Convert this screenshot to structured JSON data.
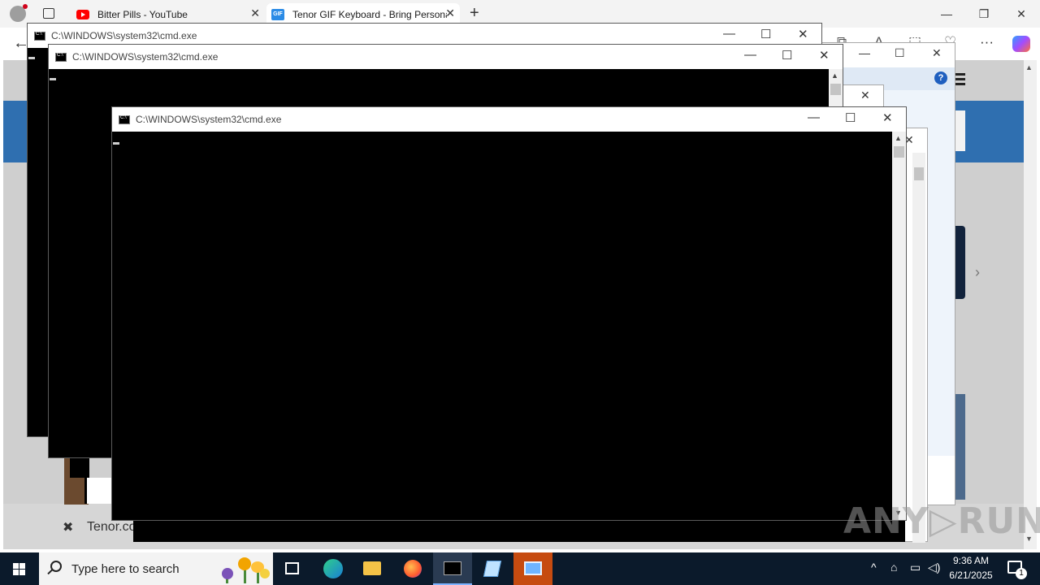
{
  "browser": {
    "tabs": [
      {
        "title": "Bitter Pills - YouTube",
        "icon": "youtube-icon"
      },
      {
        "title": "Tenor GIF Keyboard - Bring Personality",
        "icon": "gif-icon"
      }
    ],
    "new_tab": "+",
    "controls": {
      "minimize": "—",
      "restore": "❐",
      "close": "✕"
    },
    "back": "←",
    "more": "···"
  },
  "page": {
    "footer_close": "✖",
    "footer_text": "Tenor.co",
    "carousel_next": "›"
  },
  "dialogs": {
    "help": "?",
    "close": "✕",
    "minimize": "—",
    "maximize": "☐"
  },
  "cmd_windows": [
    {
      "title": "C:\\WINDOWS\\system32\\cmd.exe"
    },
    {
      "title": "C:\\WINDOWS\\system32\\cmd.exe"
    },
    {
      "title": "C:\\WINDOWS\\system32\\cmd.exe"
    }
  ],
  "cmd_controls": {
    "minimize": "—",
    "maximize": "☐",
    "close": "✕",
    "scroll_up": "▲",
    "scroll_down": "▼"
  },
  "watermark": "ANY▷RUN",
  "taskbar": {
    "search_placeholder": "Type here to search",
    "clock_time": "9:36 AM",
    "clock_date": "6/21/2025",
    "notification_count": "1",
    "tray_chevron": "^"
  },
  "colors": {
    "taskbar": "#0b1a2b",
    "cmd_bg": "#000000",
    "page_blue": "#2f6fb0"
  }
}
